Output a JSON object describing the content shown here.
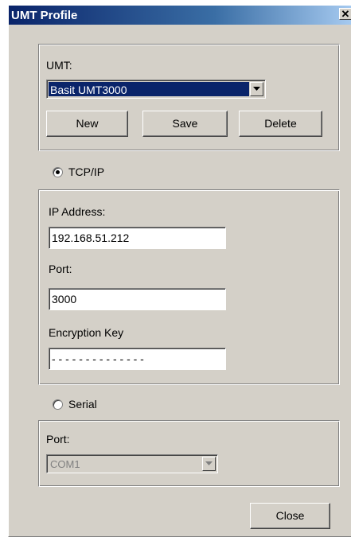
{
  "window": {
    "title": "UMT Profile",
    "close_glyph": "✕"
  },
  "umt": {
    "label": "UMT:",
    "selected": "Basit UMT3000",
    "selected_bg": "#0a246a",
    "buttons": {
      "new": "New",
      "save": "Save",
      "delete": "Delete"
    }
  },
  "tcpip": {
    "option_label": "TCP/IP",
    "selected": true,
    "ip_label": "IP Address:",
    "ip_value": "192.168.51.212",
    "port_label": "Port:",
    "port_value": "3000",
    "key_label": "Encryption Key",
    "key_value": "- - - - - - - - - - - - - -"
  },
  "serial": {
    "option_label": "Serial",
    "selected": false,
    "port_label": "Port:",
    "port_value": "COM1",
    "enabled": false
  },
  "footer": {
    "close_label": "Close"
  }
}
